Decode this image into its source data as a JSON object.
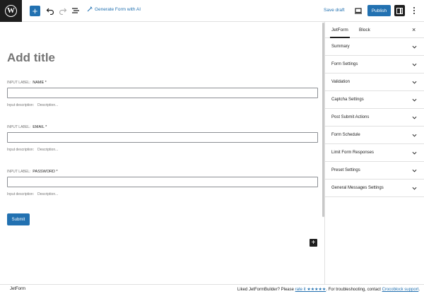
{
  "topbar": {
    "add_label": "+",
    "generate_ai_label": "Generate Form with AI",
    "save_draft_label": "Save draft",
    "publish_label": "Publish",
    "icons": {
      "logo": "wordpress-logo",
      "undo": "undo-icon",
      "redo": "redo-icon",
      "outline": "list-view-icon",
      "ai": "magic-wand-icon",
      "preview": "preview-device-icon",
      "settings": "settings-sidebar-icon",
      "more": "more-vertical-icon"
    },
    "accent": "#2271b1"
  },
  "editor": {
    "title_placeholder": "Add title",
    "fields": [
      {
        "prefix": "INPUT LABEL:",
        "label": "NAME *",
        "desc_prefix": "Input description:",
        "desc": "Description..."
      },
      {
        "prefix": "INPUT LABEL:",
        "label": "EMAIL *",
        "desc_prefix": "Input description:",
        "desc": "Description..."
      },
      {
        "prefix": "INPUT LABEL:",
        "label": "PASSWORD *",
        "desc_prefix": "Input description:",
        "desc": "Description..."
      }
    ],
    "submit_label": "Submit",
    "block_add_label": "+"
  },
  "sidebar": {
    "tabs": [
      "JetForm",
      "Block"
    ],
    "close_label": "×",
    "panels": [
      "Summary",
      "Form Settings",
      "Validation",
      "Captcha Settings",
      "Post Submit Actions",
      "Form Schedule",
      "Limit Form Responses",
      "Preset Settings",
      "General Messages Settings"
    ]
  },
  "footer": {
    "left": "JetForm",
    "right_prefix": "Liked",
    "brand": "JetFormBuilder",
    "right_mid": "? Please",
    "rate_link": "rate it ★★★★★",
    "right_tail": ". For troubleshooting, contact",
    "support_link": "Crocoblock support",
    "right_end": "."
  }
}
